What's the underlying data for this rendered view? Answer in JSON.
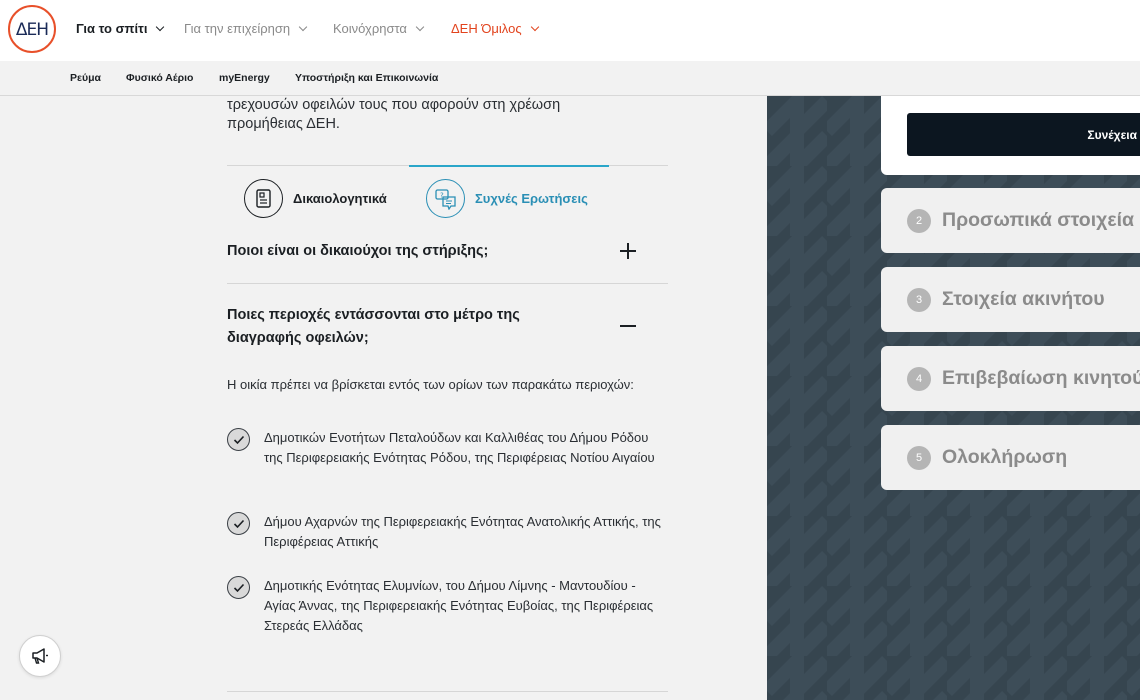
{
  "brand": {
    "logo_text": "ΔΕΗ",
    "accent": "#e2431d",
    "tab_accent": "#2a8fb5"
  },
  "topnav": {
    "items": [
      {
        "label": "Για το σπίτι"
      },
      {
        "label": "Για την επιχείρηση"
      },
      {
        "label": "Κοινόχρηστα"
      },
      {
        "label": "ΔΕΗ Όμιλος"
      }
    ]
  },
  "subnav": {
    "items": [
      {
        "label": "Ρεύμα"
      },
      {
        "label": "Φυσικό Αέριο"
      },
      {
        "label": "myEnergy"
      },
      {
        "label": "Υποστήριξη και Επικοινωνία"
      }
    ]
  },
  "content": {
    "intro_line1": "τρεχουσών οφειλών τους που αφορούν στη χρέωση",
    "intro_line2": "προμήθειας ΔΕΗ.",
    "tabs": [
      {
        "label": "Δικαιολογητικά",
        "icon": "document-icon"
      },
      {
        "label": "Συχνές Ερωτήσεις",
        "icon": "chat-question-icon"
      }
    ],
    "faq": [
      {
        "question": "Ποιοι είναι οι δικαιούχοι της στήριξης;",
        "state": "collapsed"
      },
      {
        "question": "Ποιες περιοχές εντάσσονται στο μέτρο της διαγραφής οφειλών;",
        "state": "expanded"
      }
    ],
    "answer_intro": "Η οικία πρέπει να βρίσκεται εντός των ορίων των παρακάτω περιοχών:",
    "areas": [
      "Δημοτικών Ενοτήτων Πεταλούδων και Καλλιθέας του Δήμου Ρόδου της Περιφερειακής Ενότητας Ρόδου, της Περιφέρειας Νοτίου Αιγαίου",
      "Δήμου Αχαρνών της Περιφερειακής Ενότητας Ανατολικής Αττικής, της Περιφέρειας Αττικής",
      "Δημοτικής Ενότητας Ελυμνίων, του Δήμου Λίμνης - Μαντουδίου - Αγίας Άννας, της Περιφερειακής Ενότητας Ευβοίας, της Περιφέρειας Στερεάς Ελλάδας"
    ]
  },
  "sidepanel": {
    "continue_label": "Συνέχεια",
    "steps": [
      {
        "num": "2",
        "label": "Προσωπικά στοιχεία"
      },
      {
        "num": "3",
        "label": "Στοιχεία ακινήτου"
      },
      {
        "num": "4",
        "label": "Επιβεβαίωση κινητού"
      },
      {
        "num": "5",
        "label": "Ολοκλήρωση"
      }
    ]
  },
  "promo": {
    "icon": "megaphone-icon"
  }
}
